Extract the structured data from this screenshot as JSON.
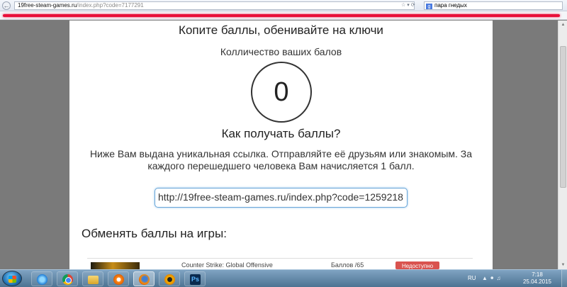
{
  "browser": {
    "url_host": "19free-steam-games.ru",
    "url_rest": "/index.php?code=7177291",
    "search_query": "пара гнедых"
  },
  "page": {
    "title": "Копите баллы, обенивайте на ключи",
    "count_label": "Колличество ваших балов",
    "count_value": "0",
    "how_title": "Как получать баллы?",
    "instructions": "Ниже Вам выдана уникальная ссылка. Отправляйте её друзьям или знакомым. За каждого перешедшего человека Вам начисляется 1 балл.",
    "referral_link": "http://19free-steam-games.ru/index.php?code=1259218",
    "exchange_title": "Обменять баллы на игры:",
    "games": [
      {
        "name": "Counter Strike: Global Offensive",
        "points": "Баллов /65",
        "button": "Недоступно"
      }
    ]
  },
  "taskbar": {
    "language": "RU",
    "time": "7:18",
    "date": "25.04.2015",
    "apps": [
      "internet-explorer-icon",
      "chrome-icon",
      "folder-icon",
      "media-player-icon",
      "firefox-icon",
      "aimp-icon",
      "photoshop-icon"
    ],
    "ps_glyph": "Ps"
  },
  "colors": {
    "accent_red": "#d9534f",
    "bookmark_line": "#e8103a",
    "link_border": "#69a6d8"
  }
}
